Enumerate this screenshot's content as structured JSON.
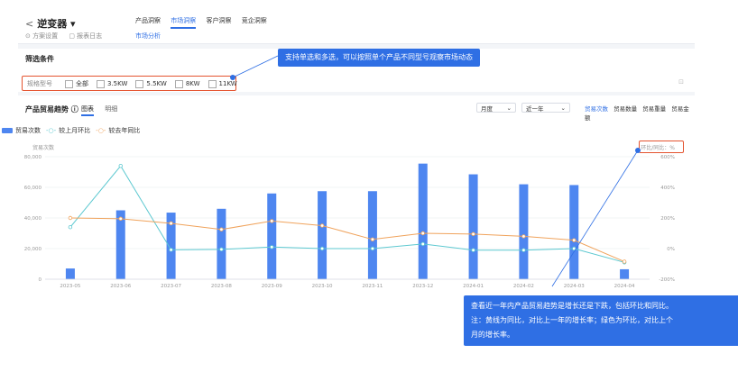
{
  "header": {
    "back_label": "<",
    "title": "逆变器 ▾",
    "solution_settings": "⊙ 方案设置",
    "report_log": "▢ 报表日志",
    "tabs": [
      "产品洞察",
      "市场洞察",
      "客户洞察",
      "竞企洞察"
    ],
    "active_tab": "市场洞察",
    "subtab": "市场分析"
  },
  "filters": {
    "title": "筛选条件",
    "label": "规格型号",
    "options": [
      "全部",
      "3.5KW",
      "5.5KW",
      "8KW",
      "11KW"
    ],
    "settings_icon": "⊡"
  },
  "trend": {
    "title": "产品贸易趋势 ⓘ",
    "view_tabs": [
      "图表",
      "明细"
    ],
    "active_view": "图表",
    "period_select": "月度",
    "range_select": "近一年",
    "metrics": [
      "贸易次数",
      "贸易数量",
      "贸易重量",
      "贸易金额"
    ],
    "active_metric": "贸易次数",
    "legend": [
      "贸易次数",
      "较上月环比",
      "较去年同比"
    ]
  },
  "chart_data": {
    "type": "bar",
    "ylabel": "贸易次数",
    "y2label": "环比/同比：%",
    "ylim": [
      0,
      80000
    ],
    "y2lim": [
      -200,
      600
    ],
    "y_ticks": [
      "0",
      "20,000",
      "40,000",
      "60,000",
      "80,000"
    ],
    "y2_ticks": [
      "-200%",
      "0%",
      "200%",
      "400%",
      "600%"
    ],
    "categories": [
      "2023-05",
      "2023-06",
      "2023-07",
      "2023-08",
      "2023-09",
      "2023-10",
      "2023-11",
      "2023-12",
      "2024-01",
      "2024-02",
      "2024-03",
      "2024-04"
    ],
    "series": [
      {
        "name": "贸易次数",
        "kind": "bar",
        "color": "#4e86f0",
        "values": [
          7000,
          45000,
          43500,
          46000,
          56000,
          57500,
          57500,
          75500,
          68500,
          62000,
          61500,
          6500
        ]
      },
      {
        "name": "较上月环比",
        "kind": "line",
        "color": "#5cc8d0",
        "values": [
          140,
          540,
          -8,
          -5,
          10,
          0,
          0,
          30,
          -10,
          -10,
          0,
          -90
        ]
      },
      {
        "name": "较去年同比",
        "kind": "line",
        "color": "#f0a35c",
        "values": [
          200,
          195,
          165,
          125,
          180,
          150,
          60,
          100,
          95,
          80,
          55,
          -85
        ]
      }
    ]
  },
  "callouts": {
    "filter_tip": "支持单选和多选，可以按照单个产品不同型号观察市场动态",
    "trend_tip_1": "查看近一年内产品贸易趋势是增长还是下跌，包括环比和同比。",
    "trend_tip_2": "注：黄线为同比，对比上一年的增长率；绿色为环比，对比上个",
    "trend_tip_3": "月的增长率。"
  },
  "colors": {
    "accent": "#2f6fe4",
    "highlight": "#e4532f"
  }
}
